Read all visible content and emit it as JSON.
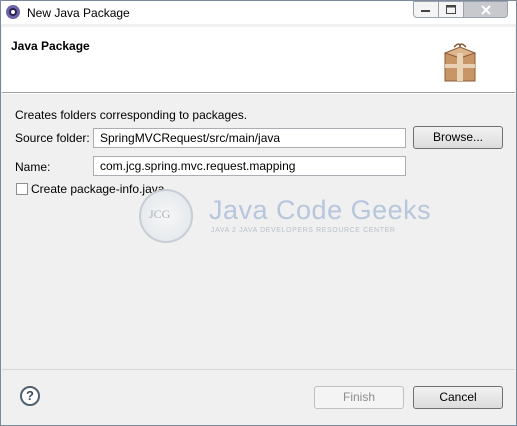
{
  "window": {
    "title": "New Java Package"
  },
  "header": {
    "title": "Java Package"
  },
  "form": {
    "description": "Creates folders corresponding to packages.",
    "source_folder_label": "Source folder:",
    "source_folder_value": "SpringMVCRequest/src/main/java",
    "browse_label": "Browse...",
    "name_label": "Name:",
    "name_value": "com.jcg.spring.mvc.request.mapping",
    "create_package_info_label": "Create package-info.java",
    "create_package_info_checked": false
  },
  "watermark": {
    "logo_text": "JCG",
    "title": "Java Code Geeks",
    "subtitle": "JAVA 2 JAVA DEVELOPERS RESOURCE CENTER"
  },
  "footer": {
    "help_glyph": "?",
    "finish_label": "Finish",
    "cancel_label": "Cancel"
  },
  "icons": {
    "app": "eclipse-icon",
    "header": "package-icon",
    "help": "help-icon"
  },
  "colors": {
    "header_bg": "#ffffff",
    "dialog_bg": "#f0f0f0"
  }
}
